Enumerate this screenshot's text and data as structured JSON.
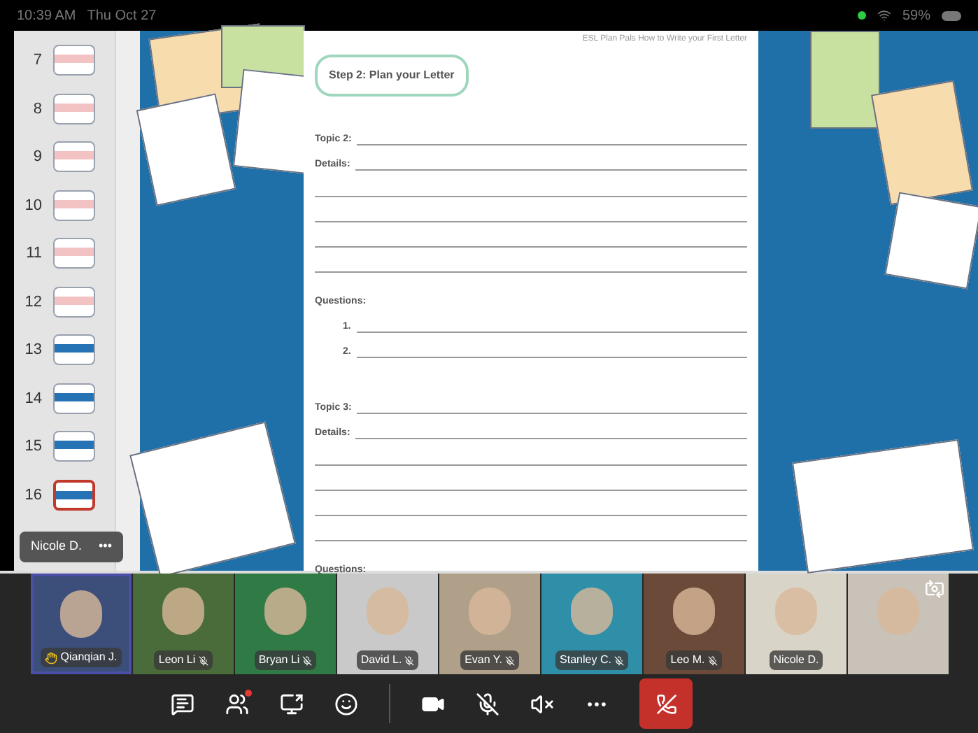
{
  "status_bar": {
    "time": "10:39 AM",
    "date": "Thu Oct 27",
    "battery": "59%"
  },
  "slides": [
    {
      "number": "7",
      "selected": false
    },
    {
      "number": "8",
      "selected": false
    },
    {
      "number": "9",
      "selected": false
    },
    {
      "number": "10",
      "selected": false
    },
    {
      "number": "11",
      "selected": false
    },
    {
      "number": "12",
      "selected": false
    },
    {
      "number": "13",
      "selected": false
    },
    {
      "number": "14",
      "selected": false
    },
    {
      "number": "15",
      "selected": false
    },
    {
      "number": "16",
      "selected": true
    }
  ],
  "presenter_tag": {
    "name": "Nicole D.",
    "more": "•••"
  },
  "document": {
    "header": "ESL Plan Pals How to Write your First Letter",
    "step_title": "Step 2: Plan your Letter",
    "lines": [
      {
        "kind": "field",
        "label": "Topic 2:"
      },
      {
        "kind": "field",
        "label": "Details:"
      },
      {
        "kind": "blank"
      },
      {
        "kind": "blank"
      },
      {
        "kind": "blank"
      },
      {
        "kind": "blank"
      },
      {
        "kind": "heading",
        "label": "Questions:"
      },
      {
        "kind": "numbered",
        "label": "1."
      },
      {
        "kind": "numbered",
        "label": "2."
      },
      {
        "kind": "gap"
      },
      {
        "kind": "field",
        "label": "Topic 3:"
      },
      {
        "kind": "field",
        "label": "Details:"
      },
      {
        "kind": "blank"
      },
      {
        "kind": "blank"
      },
      {
        "kind": "blank"
      },
      {
        "kind": "blank"
      },
      {
        "kind": "heading",
        "label": "Questions:"
      }
    ]
  },
  "participants": [
    {
      "name": "Qianqian J.",
      "muted": false,
      "hand_raised": true,
      "selected": true
    },
    {
      "name": "Leon Li",
      "muted": true,
      "hand_raised": false,
      "selected": false
    },
    {
      "name": "Bryan Li",
      "muted": true,
      "hand_raised": false,
      "selected": false
    },
    {
      "name": "David L.",
      "muted": true,
      "hand_raised": false,
      "selected": false
    },
    {
      "name": "Evan Y.",
      "muted": true,
      "hand_raised": false,
      "selected": false
    },
    {
      "name": "Stanley C.",
      "muted": true,
      "hand_raised": false,
      "selected": false
    },
    {
      "name": "Leo M.",
      "muted": true,
      "hand_raised": false,
      "selected": false
    },
    {
      "name": "Nicole D.",
      "muted": false,
      "hand_raised": false,
      "selected": false
    },
    {
      "selected": false
    }
  ],
  "controls": {
    "participants_alert": true,
    "mic_muted": true,
    "speaker_muted": true
  }
}
